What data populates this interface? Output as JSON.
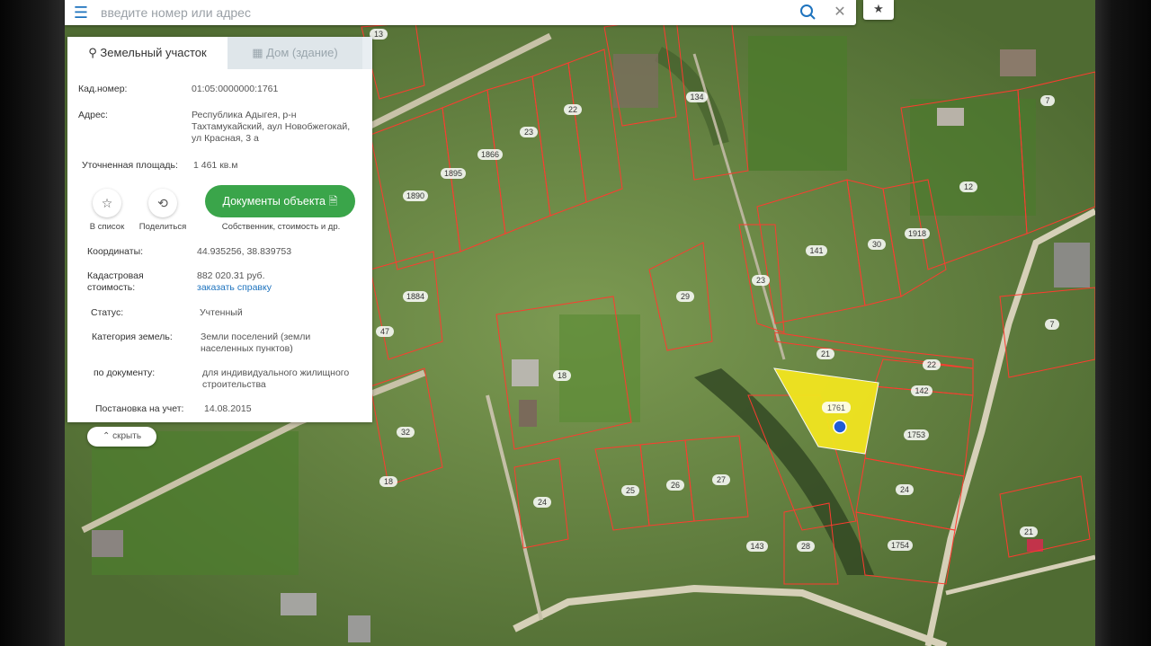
{
  "search": {
    "placeholder": "введите номер или адрес"
  },
  "icons": {
    "menu": "menu-icon",
    "search": "search-icon",
    "clear": "close-icon",
    "star": "star-icon",
    "share": "share-icon",
    "document": "document-icon",
    "pin": "pin-icon",
    "building": "building-icon"
  },
  "tabs": [
    {
      "label": "Земельный участок",
      "active": true
    },
    {
      "label": "Дом (здание)",
      "active": false
    }
  ],
  "parcel": {
    "cad_label": "Кад.номер:",
    "cad_value": "01:05:0000000:1761",
    "address_label": "Адрес:",
    "address_value": "Республика Адыгея, р-н Тахтамукайский, аул Новобжегокай, ул Красная, 3 а",
    "area_label": "Уточненная площадь:",
    "area_value": "1 461 кв.м",
    "coords_label": "Координаты:",
    "coords_value": "44.935256, 38.839753",
    "cost_label_1": "Кадастровая",
    "cost_label_2": "стоимость:",
    "cost_value": "882 020.31 руб.",
    "cost_link": "заказать справку",
    "status_label": "Статус:",
    "status_value": "Учтенный",
    "category_label": "Категория земель:",
    "category_value": "Земли поселений (земли населенных пунктов)",
    "doc_label": "по документу:",
    "doc_value": "для индивидуального жилищного строительства",
    "reg_label": "Постановка на учет:",
    "reg_value": "14.08.2015"
  },
  "actions": {
    "add_list": "В список",
    "share": "Поделиться",
    "docs_button": "Документы объекта",
    "docs_sub": "Собственник, стоимость и др."
  },
  "hide_button": "скрыть",
  "map": {
    "selected_label": "1761",
    "highlight_color": "#f2e520",
    "boundary_color": "#ff3b2f",
    "marker_color": "#1e5bd6",
    "labels": [
      "13",
      "134",
      "22",
      "23",
      "1866",
      "1895",
      "1890",
      "1884",
      "29",
      "141",
      "30",
      "1918",
      "12",
      "7",
      "23",
      "21",
      "22",
      "142",
      "1753",
      "18",
      "32",
      "24",
      "25",
      "26",
      "27",
      "24",
      "143",
      "28",
      "1754",
      "21",
      "7",
      "47",
      "18"
    ]
  }
}
